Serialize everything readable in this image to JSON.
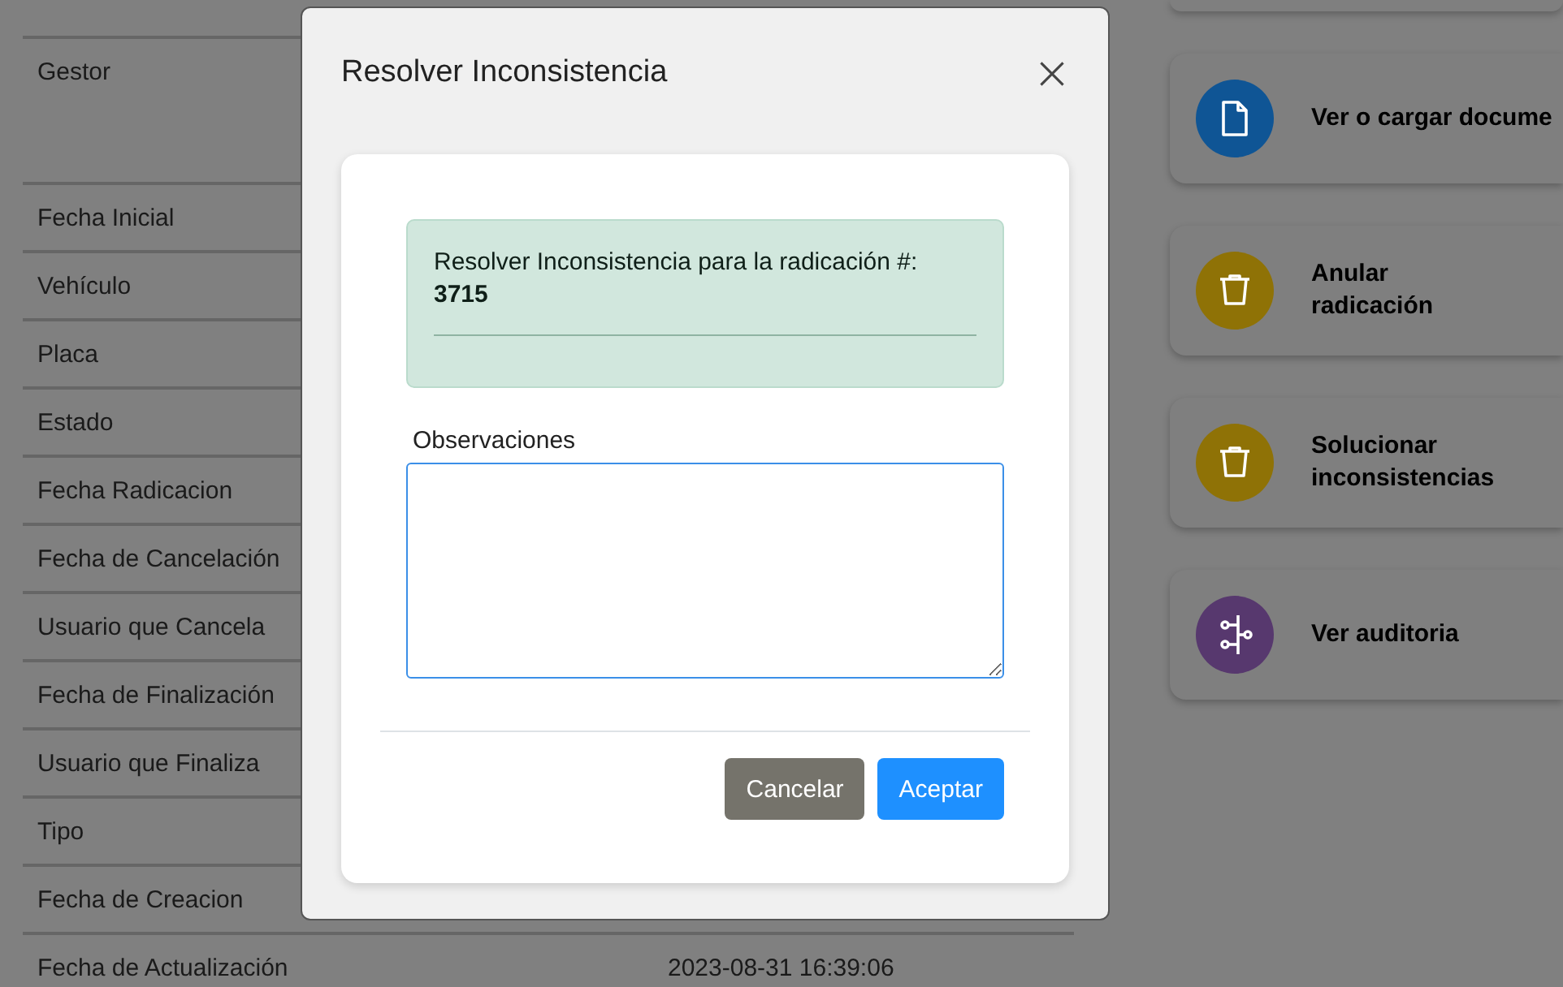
{
  "details": [
    {
      "label": "Gestor"
    },
    {
      "label": "Fecha Inicial"
    },
    {
      "label": "Vehículo"
    },
    {
      "label": "Placa"
    },
    {
      "label": "Estado"
    },
    {
      "label": "Fecha Radicacion"
    },
    {
      "label": "Fecha de Cancelación"
    },
    {
      "label": "Usuario que Cancela"
    },
    {
      "label": "Fecha de Finalización"
    },
    {
      "label": "Usuario que Finaliza"
    },
    {
      "label": "Tipo"
    },
    {
      "label": "Fecha de Creacion"
    },
    {
      "label": "Fecha de Actualización",
      "value": "2023-08-31 16:39:06"
    }
  ],
  "actions": [
    {
      "label": "Ver o cargar docume",
      "kind": "document",
      "color": "#0f5595"
    },
    {
      "label": "Anular radicación",
      "kind": "trash",
      "color": "#8f7206"
    },
    {
      "label": "Solucionar inconsistencias",
      "kind": "trash",
      "color": "#8f7206"
    },
    {
      "label": "Ver auditoria",
      "kind": "timeline",
      "color": "#57386e"
    }
  ],
  "dialog": {
    "title": "Resolver Inconsistencia",
    "alert_text": "Resolver Inconsistencia para la radicación #:",
    "alert_number": "3715",
    "field_label": "Observaciones",
    "buttons": [
      {
        "label": "Cancelar",
        "kind": "secondary"
      },
      {
        "label": "Aceptar",
        "kind": "primary"
      }
    ]
  }
}
